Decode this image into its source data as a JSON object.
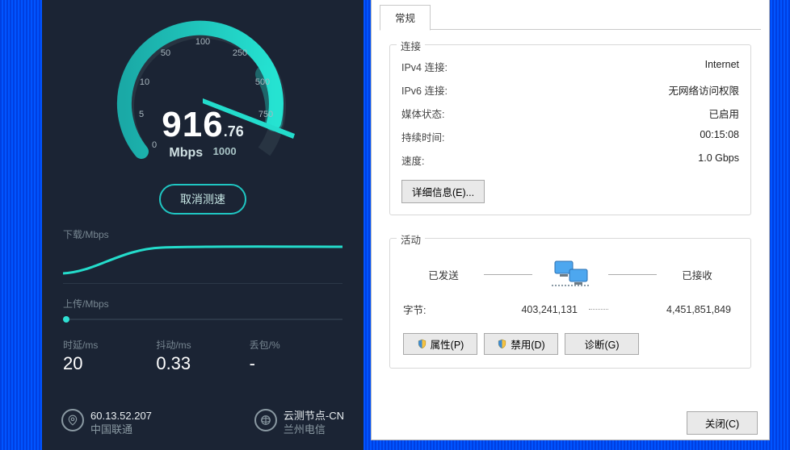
{
  "speedtest": {
    "gauge": {
      "ticks": [
        "0",
        "5",
        "10",
        "50",
        "100",
        "250",
        "500",
        "750",
        "1000"
      ],
      "value_int": "916",
      "value_frac": ".76",
      "unit": "Mbps",
      "end_tick": "1000"
    },
    "cancel_btn": "取消测速",
    "download_label": "下载/Mbps",
    "upload_label": "上传/Mbps",
    "metrics": {
      "latency_label": "时延/ms",
      "latency_value": "20",
      "jitter_label": "抖动/ms",
      "jitter_value": "0.33",
      "loss_label": "丢包/%",
      "loss_value": "-"
    },
    "footer": {
      "ip": "60.13.52.207",
      "isp": "中国联通",
      "node_l1": "云测节点-CN",
      "node_l2": "兰州电信"
    }
  },
  "nic": {
    "tab": "常规",
    "conn_title": "连接",
    "rows": {
      "ipv4_k": "IPv4 连接:",
      "ipv4_v": "Internet",
      "ipv6_k": "IPv6 连接:",
      "ipv6_v": "无网络访问权限",
      "media_k": "媒体状态:",
      "media_v": "已启用",
      "dur_k": "持续时间:",
      "dur_v": "00:15:08",
      "speed_k": "速度:",
      "speed_v": "1.0 Gbps"
    },
    "details_btn": "详细信息(E)...",
    "activity_title": "活动",
    "sent_label": "已发送",
    "recv_label": "已接收",
    "bytes_label": "字节:",
    "sent_bytes": "403,241,131",
    "recv_bytes": "4,451,851,849",
    "buttons": {
      "props": "属性(P)",
      "disable": "禁用(D)",
      "diag": "诊断(G)"
    },
    "close_btn": "关闭(C)"
  }
}
